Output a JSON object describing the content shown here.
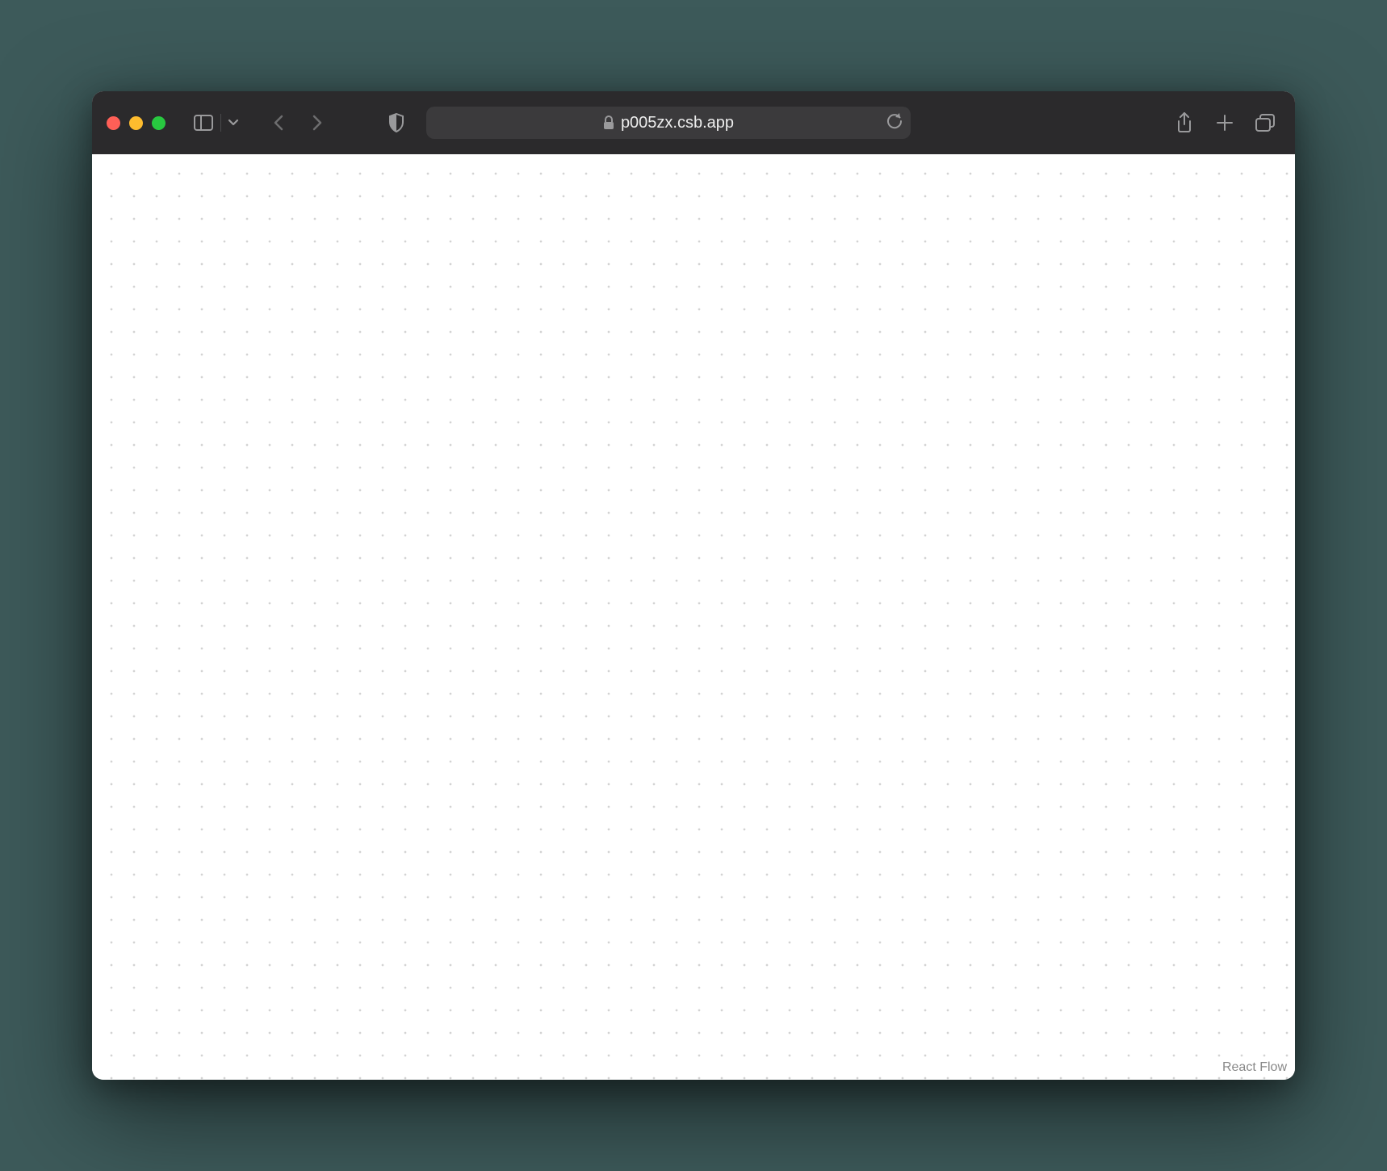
{
  "address_bar": {
    "url_display": "p005zx.csb.app"
  },
  "content": {
    "attribution": "React Flow"
  }
}
